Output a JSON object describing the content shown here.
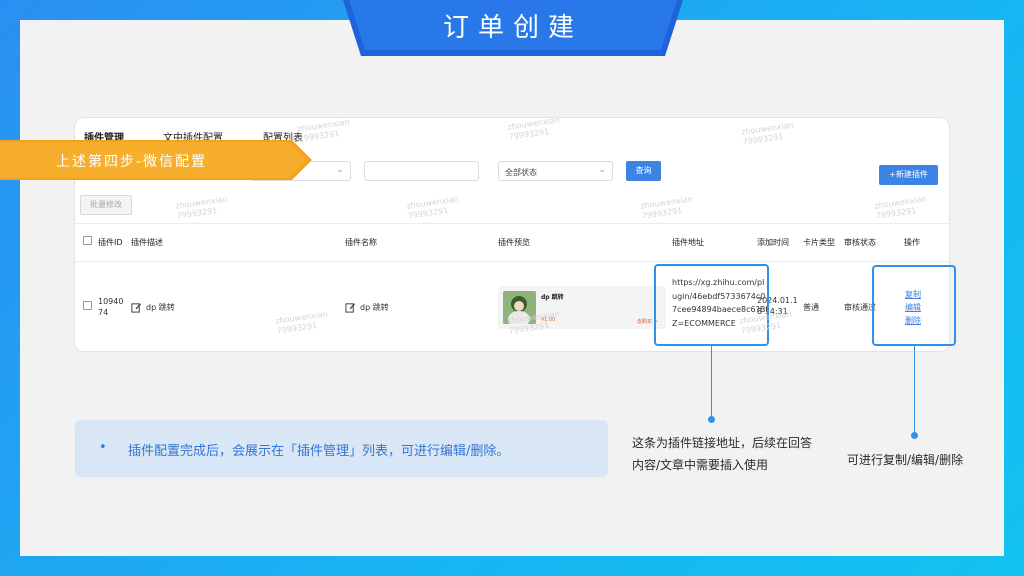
{
  "page": {
    "title": "订单创建"
  },
  "step_label": "上述第四步-微信配置",
  "tabs": [
    {
      "label": "插件管理",
      "active": true
    },
    {
      "label": "文中插件配置",
      "active": false
    },
    {
      "label": "配置列表",
      "active": false
    }
  ],
  "filters": {
    "status_select": "全部状态",
    "query_button": "查询",
    "new_button": "+新建插件",
    "batch_button": "批量修改"
  },
  "table": {
    "headers": [
      "插件ID",
      "插件描述",
      "插件名称",
      "插件预览",
      "插件地址",
      "添加时间",
      "卡片类型",
      "审核状态",
      "操作"
    ],
    "row": {
      "id": "1094074",
      "description": "dp 跳转",
      "name": "dp 跳转",
      "preview_title": "dp 跳转",
      "preview_price": "¥1.00",
      "preview_buy": "去购买 >",
      "url": "https://xg.zhihu.com/plugin/46ebdf5733674c07cee94894baece8c6?BIZ=ECOMMERCE",
      "added_time": "2024.01.18 14:31",
      "card_type": "普通",
      "review_status": "审核通过",
      "actions": [
        "复制",
        "编辑",
        "删除"
      ]
    }
  },
  "note": "插件配置完成后，会展示在「插件管理」列表，可进行编辑/删除。",
  "callouts": {
    "url": "这条为插件链接地址，后续在回答内容/文章中需要插入使用",
    "actions": "可进行复制/编辑/删除"
  },
  "watermark": {
    "line1": "zhouwenxian",
    "line2": "79993291"
  },
  "colors": {
    "accent": "#2f92e8",
    "button": "#3d83e6",
    "ribbon": "#f3a21f",
    "banner": "#1e63d9"
  }
}
